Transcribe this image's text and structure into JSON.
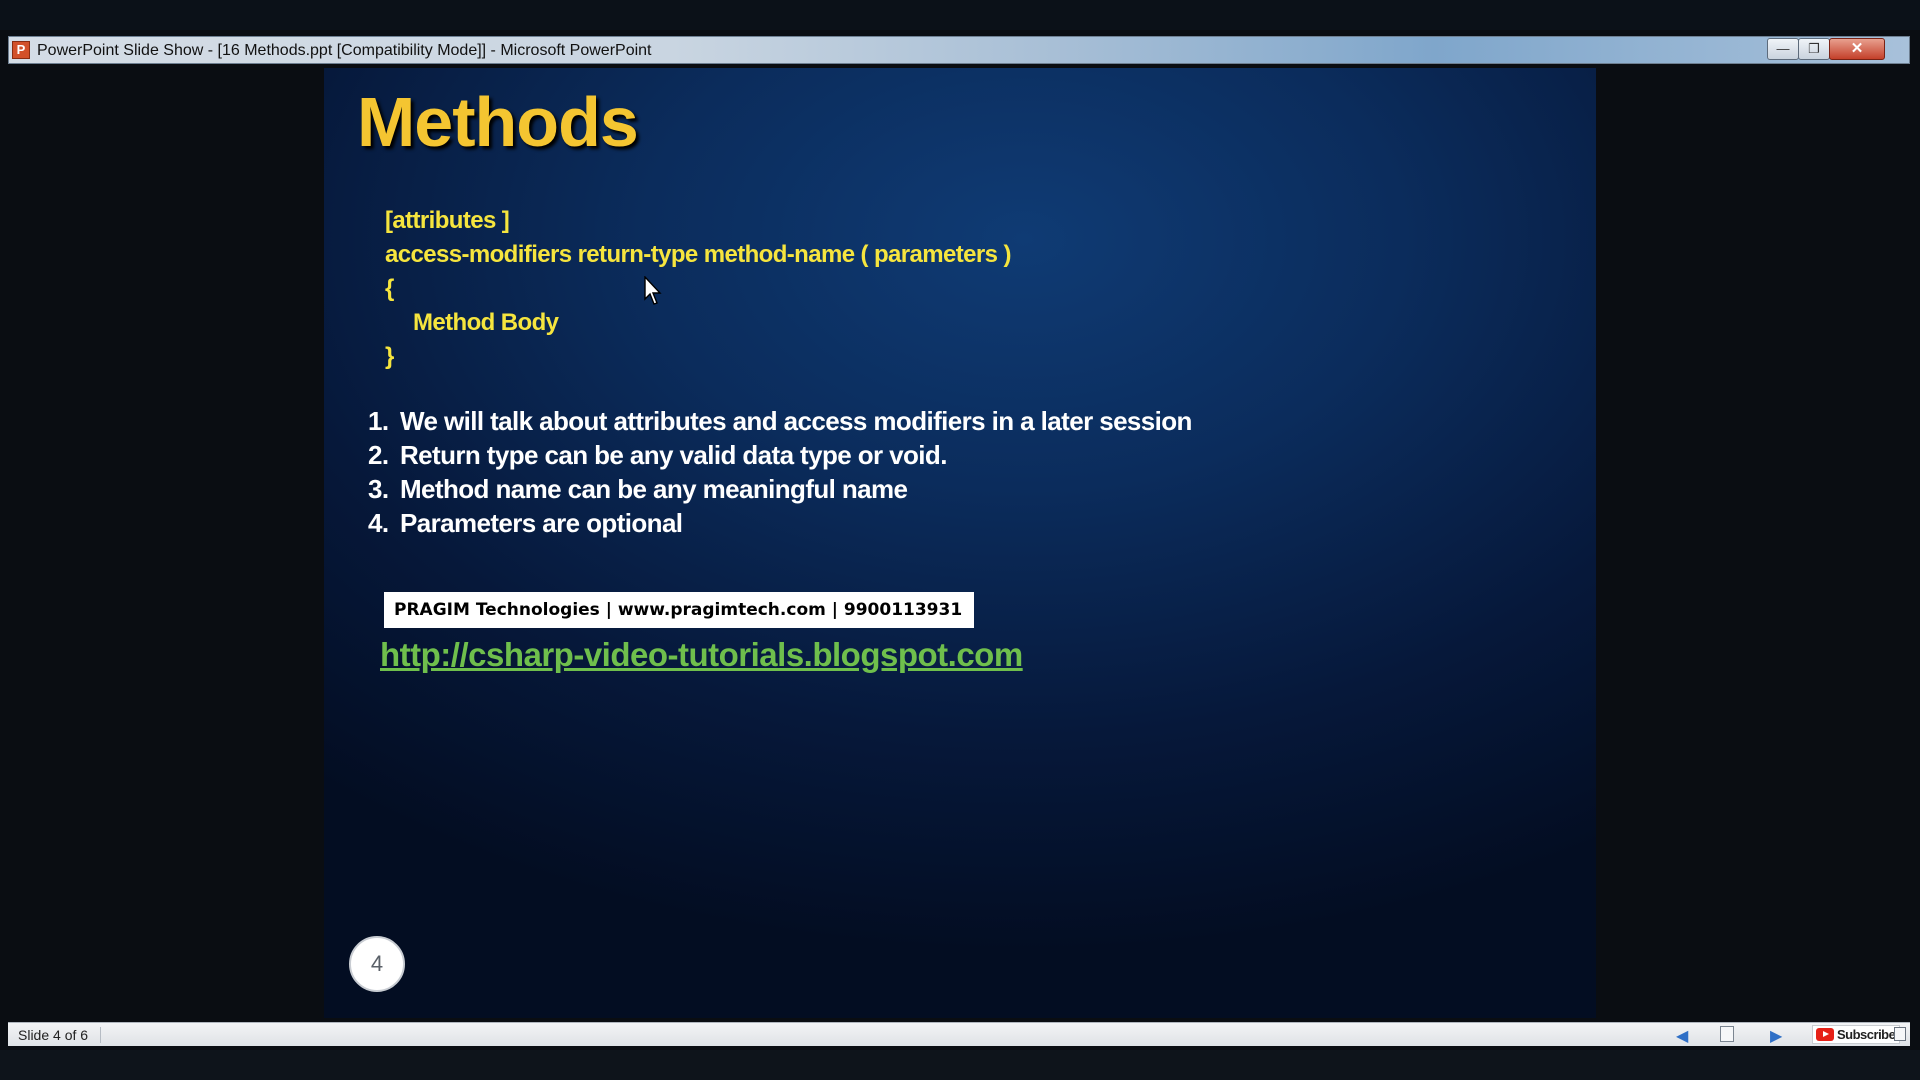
{
  "window": {
    "title": "PowerPoint Slide Show - [16 Methods.ppt [Compatibility Mode]] - Microsoft PowerPoint",
    "app_icon_letter": "P",
    "controls": {
      "minimize": "—",
      "maximize": "❐",
      "close": "✕"
    }
  },
  "slide": {
    "title": "Methods",
    "code": {
      "attributes_line": "[attributes ]",
      "signature_line": "access-modifiers return-type method-name ( parameters )",
      "open_brace": "{",
      "body_line": "Method Body",
      "close_brace": "}"
    },
    "points": [
      {
        "num": "1.",
        "text": "We will talk about attributes and access modifiers in a later session"
      },
      {
        "num": "2.",
        "text": "Return type can be any valid data type or void."
      },
      {
        "num": "3.",
        "text": "Method name can be any meaningful name"
      },
      {
        "num": "4.",
        "text": "Parameters are optional"
      }
    ],
    "banner": "PRAGIM Technologies | www.pragimtech.com | 9900113931",
    "link": "http://csharp-video-tutorials.blogspot.com",
    "number": "4"
  },
  "statusbar": {
    "slide_indicator": "Slide 4 of 6",
    "prev_icon": "◀",
    "next_icon": "▶",
    "subscribe_label": "Subscribe"
  },
  "colors": {
    "title": "#f4c531",
    "code": "#f6e53e",
    "link": "#6fbf4c",
    "slide_bg": "#0b2c5c"
  }
}
